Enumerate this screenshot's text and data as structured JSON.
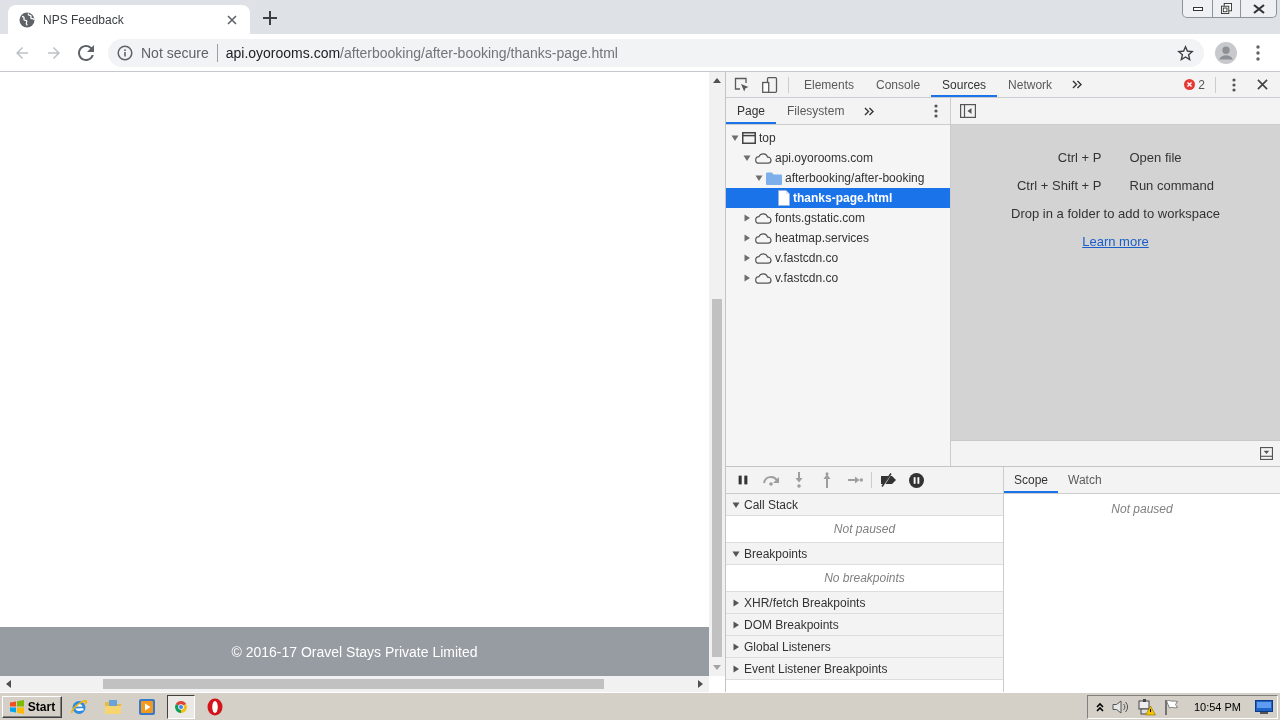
{
  "browser": {
    "tabs": [
      {
        "title": "NPS Feedback",
        "selected": true
      }
    ],
    "nav_buttons": [
      {
        "kind": "back",
        "disabled": true
      },
      {
        "kind": "forward",
        "disabled": true
      },
      {
        "kind": "reload",
        "disabled": false
      }
    ],
    "address_bar": {
      "security": "Not secure",
      "host": "api.oyorooms.com",
      "path": "/afterbooking/after-booking/thanks-page.html"
    }
  },
  "page": {
    "footer_text": "© 2016-17 Oravel Stays Private Limited"
  },
  "devtools": {
    "panel_tabs": [
      {
        "label": "Elements",
        "selected": false
      },
      {
        "label": "Console",
        "selected": false
      },
      {
        "label": "Sources",
        "selected": true
      },
      {
        "label": "Network",
        "selected": false
      }
    ],
    "error_count": "2",
    "navigator_tabs": [
      {
        "label": "Page",
        "selected": true
      },
      {
        "label": "Filesystem",
        "selected": false
      }
    ],
    "tree": [
      {
        "label": "top",
        "kind": "frame",
        "expanded": true,
        "selected": false,
        "children": [
          {
            "label": "api.oyorooms.com",
            "kind": "domain",
            "expanded": true,
            "selected": false,
            "children": [
              {
                "label": "afterbooking/after-booking",
                "kind": "folder",
                "expanded": true,
                "selected": false,
                "children": [
                  {
                    "label": "thanks-page.html",
                    "kind": "file",
                    "selected": true
                  }
                ]
              }
            ]
          },
          {
            "label": "fonts.gstatic.com",
            "kind": "domain",
            "expanded": false,
            "selected": false
          },
          {
            "label": "heatmap.services",
            "kind": "domain",
            "expanded": false,
            "selected": false
          },
          {
            "label": "v.fastcdn.co",
            "kind": "domain",
            "expanded": false,
            "selected": false
          },
          {
            "label": "v.fastcdn.co",
            "kind": "domain",
            "expanded": false,
            "selected": false
          }
        ]
      }
    ],
    "shortcuts": [
      {
        "keys": "Ctrl + P",
        "action": "Open file"
      },
      {
        "keys": "Ctrl + Shift + P",
        "action": "Run command"
      }
    ],
    "drop_hint": "Drop in a folder to add to workspace",
    "learn_more": "Learn more",
    "debugger_controls": [
      {
        "kind": "pause",
        "disabled": false
      },
      {
        "kind": "stepover",
        "disabled": true
      },
      {
        "kind": "stepinto",
        "disabled": true
      },
      {
        "kind": "stepout",
        "disabled": true
      },
      {
        "kind": "step",
        "disabled": true
      },
      {
        "kind": "deactivate",
        "disabled": false
      },
      {
        "kind": "exceptions",
        "disabled": false
      }
    ],
    "sections": [
      {
        "title": "Call Stack",
        "expanded": true,
        "message": "Not paused"
      },
      {
        "title": "Breakpoints",
        "expanded": true,
        "message": "No breakpoints"
      },
      {
        "title": "XHR/fetch Breakpoints",
        "expanded": false
      },
      {
        "title": "DOM Breakpoints",
        "expanded": false
      },
      {
        "title": "Global Listeners",
        "expanded": false
      },
      {
        "title": "Event Listener Breakpoints",
        "expanded": false
      }
    ],
    "sidebar_tabs": [
      {
        "label": "Scope",
        "selected": true
      },
      {
        "label": "Watch",
        "selected": false
      }
    ],
    "scope_message": "Not paused"
  },
  "taskbar": {
    "start_label": "Start",
    "apps": [
      {
        "kind": "globe",
        "selected": false
      },
      {
        "kind": "folder",
        "selected": false
      },
      {
        "kind": "player",
        "selected": false
      },
      {
        "kind": "wheel",
        "selected": true
      },
      {
        "kind": "ring",
        "selected": false
      }
    ],
    "clock": "10:54 PM"
  }
}
